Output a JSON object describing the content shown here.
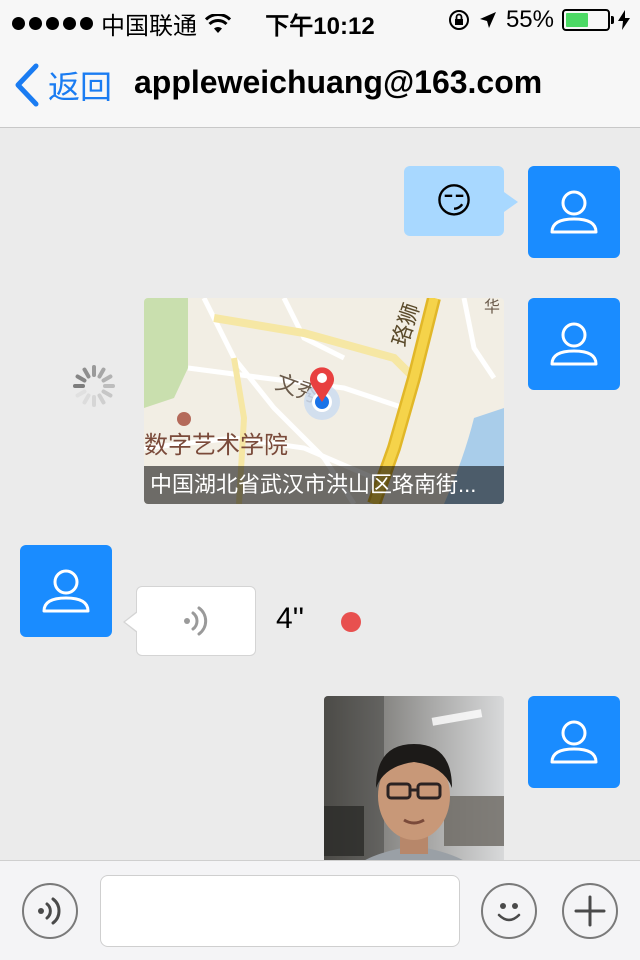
{
  "status_bar": {
    "carrier": "中国联通",
    "time": "下午10:12",
    "battery_percent": "55%",
    "battery_level": 0.55,
    "signal_icon": "signal-dots-icon",
    "wifi_icon": "wifi-icon",
    "orientation_lock_icon": "orientation-lock-icon",
    "location_icon": "location-arrow-icon",
    "charging_icon": "charging-bolt-icon"
  },
  "nav": {
    "back_label": "返回",
    "title": "appleweichuang@163.com"
  },
  "messages": [
    {
      "type": "emoji",
      "from": "me",
      "content": "😏"
    },
    {
      "type": "location",
      "from": "me",
      "address": "中国湖北省武汉市洪山区珞南街...",
      "map_labels": [
        "文秀",
        "数字艺术学院",
        "珞狮"
      ]
    },
    {
      "type": "voice",
      "from": "other",
      "duration": "4''",
      "unread": true
    },
    {
      "type": "image",
      "from": "me"
    }
  ],
  "input_bar": {
    "voice_icon": "voice-toggle-icon",
    "emoji_icon": "emoji-icon",
    "add_icon": "plus-icon",
    "placeholder": ""
  },
  "colors": {
    "accent": "#1a7cf2",
    "avatar": "#1a8cff",
    "unread_dot": "#e8504f",
    "my_bubble": "#a8d8ff"
  }
}
